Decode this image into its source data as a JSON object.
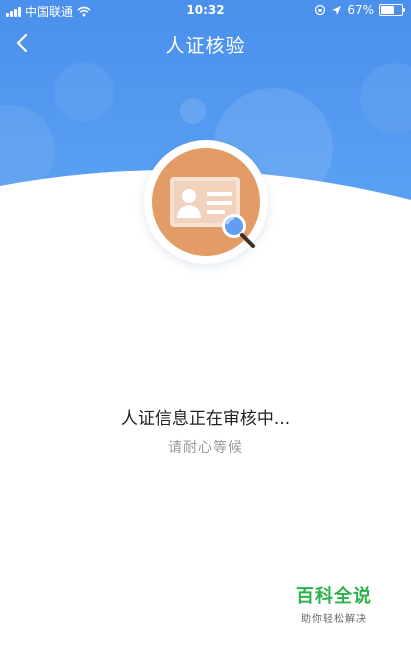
{
  "status_bar": {
    "carrier": "中国联通",
    "time": "10:32",
    "battery": "67%"
  },
  "nav": {
    "title": "人证核验"
  },
  "main": {
    "status_text": "人证信息正在审核中...",
    "sub_text": "请耐心等候"
  },
  "watermark": {
    "title": "百科全说",
    "subtitle": "助你轻松解决"
  },
  "colors": {
    "header_blue": "#4a92ee",
    "badge_orange": "#e39b68",
    "watermark_green": "#2bb24c"
  }
}
